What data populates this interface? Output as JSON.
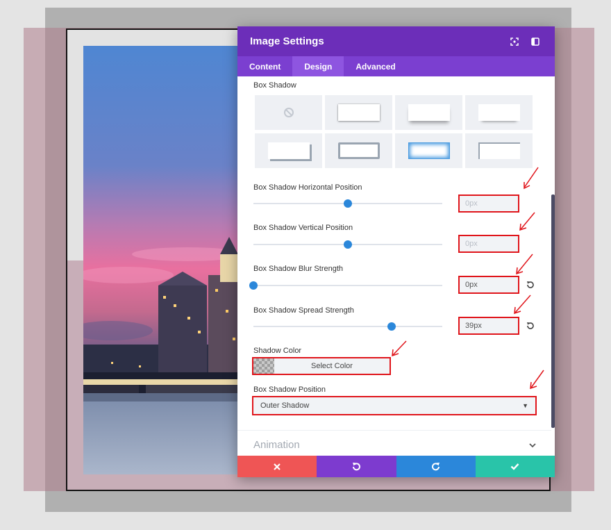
{
  "panel": {
    "title": "Image Settings",
    "tabs": [
      {
        "label": "Content",
        "active": false
      },
      {
        "label": "Design",
        "active": true
      },
      {
        "label": "Advanced",
        "active": false
      }
    ]
  },
  "box_shadow": {
    "label": "Box Shadow",
    "presets": [
      "none",
      "soft-all",
      "bottom-fade",
      "bottom-thin",
      "offset-solid",
      "inset-border",
      "inset-glow",
      "inset-corner"
    ]
  },
  "fields": {
    "horizontal": {
      "label": "Box Shadow Horizontal Position",
      "value": "0px",
      "slider_fraction": 0.5
    },
    "vertical": {
      "label": "Box Shadow Vertical Position",
      "value": "0px",
      "slider_fraction": 0.5
    },
    "blur": {
      "label": "Box Shadow Blur Strength",
      "value": "0px",
      "slider_fraction": 0.0
    },
    "spread": {
      "label": "Box Shadow Spread Strength",
      "value": "39px",
      "slider_fraction": 0.73
    }
  },
  "shadow_color": {
    "label": "Shadow Color",
    "button_label": "Select Color"
  },
  "shadow_position": {
    "label": "Box Shadow Position",
    "value": "Outer Shadow"
  },
  "animation": {
    "label": "Animation"
  },
  "icons": {
    "header": [
      "focus-icon",
      "split-view-icon"
    ],
    "footer": [
      "close-icon",
      "undo-icon",
      "redo-icon",
      "checkmark-icon"
    ]
  },
  "colors": {
    "header": "#6c2eb9",
    "tabs": "#7b3fd0",
    "accent": "#2b87da",
    "highlight": "#e0141a",
    "cancel": "#ef5555",
    "undo": "#7d3bcf",
    "redo": "#2b87da",
    "save": "#29c4a9"
  }
}
